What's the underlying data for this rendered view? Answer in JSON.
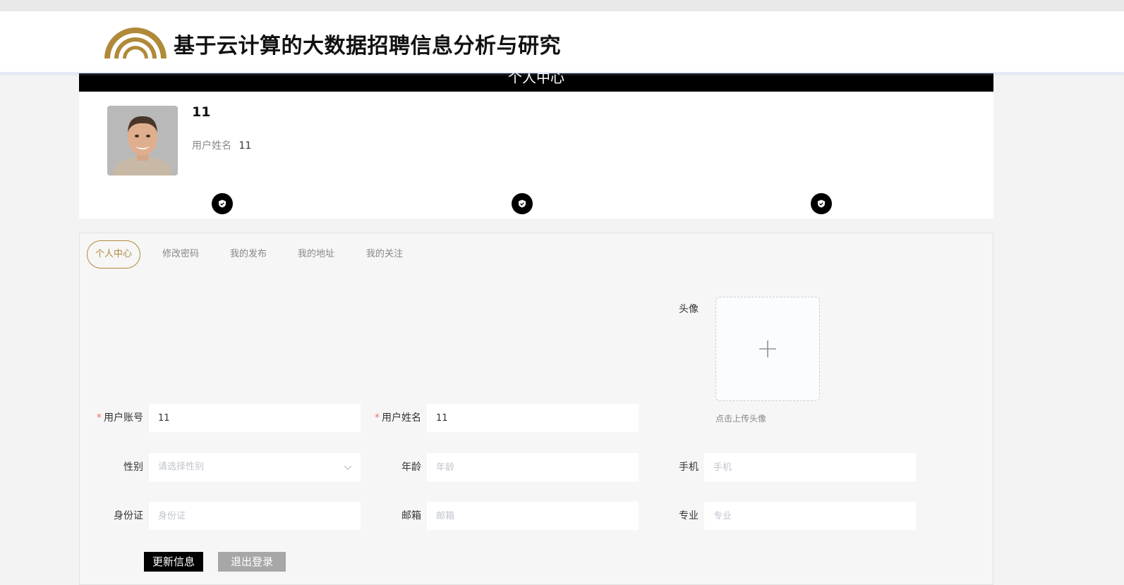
{
  "header": {
    "site_title": "基于云计算的大数据招聘信息分析与研究",
    "brand_color": "#b08a3a"
  },
  "banner": {
    "title": "个人中心"
  },
  "profile": {
    "name": "11",
    "username_label": "用户姓名",
    "username_value": "11",
    "badge_icon": "shield-check-icon"
  },
  "tabs": [
    {
      "label": "个人中心",
      "active": true
    },
    {
      "label": "修改密码",
      "active": false
    },
    {
      "label": "我的发布",
      "active": false
    },
    {
      "label": "我的地址",
      "active": false
    },
    {
      "label": "我的关注",
      "active": false
    }
  ],
  "form": {
    "avatar_label": "头像",
    "upload_hint": "点击上传头像",
    "account": {
      "label": "用户账号",
      "value": "11",
      "required": true
    },
    "name": {
      "label": "用户姓名",
      "value": "11",
      "required": true
    },
    "gender": {
      "label": "性别",
      "placeholder": "请选择性别"
    },
    "age": {
      "label": "年龄",
      "placeholder": "年龄"
    },
    "phone": {
      "label": "手机",
      "placeholder": "手机"
    },
    "id_card": {
      "label": "身份证",
      "placeholder": "身份证"
    },
    "email": {
      "label": "邮箱",
      "placeholder": "邮箱"
    },
    "major": {
      "label": "专业",
      "placeholder": "专业"
    }
  },
  "buttons": {
    "update": "更新信息",
    "logout": "退出登录"
  },
  "colors": {
    "accent": "#b08a3a",
    "banner": "#000000",
    "required": "#f56c6c"
  }
}
